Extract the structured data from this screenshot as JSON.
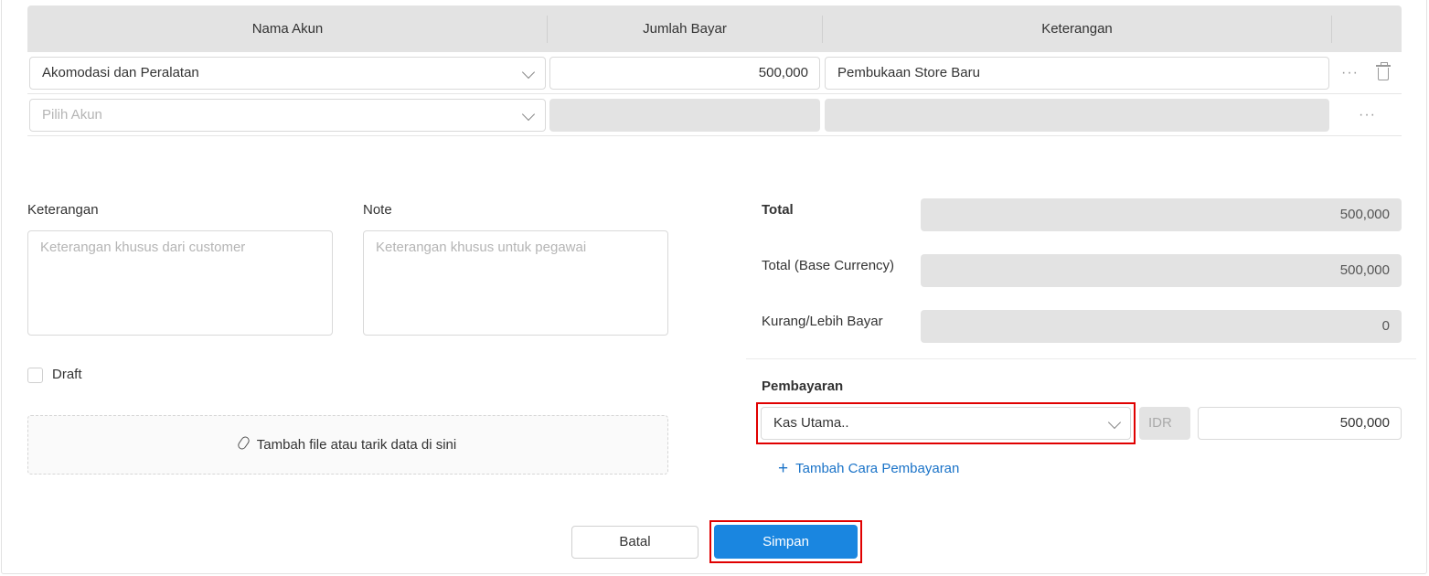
{
  "table": {
    "headers": [
      "Nama Akun",
      "Jumlah Bayar",
      "Keterangan"
    ],
    "rows": [
      {
        "account": "Akomodasi dan Peralatan",
        "amount": "500,000",
        "note": "Pembukaan Store Baru"
      }
    ],
    "new_row": {
      "account_placeholder": "Pilih Akun"
    },
    "more_icon_glyph": "···"
  },
  "memo": {
    "keterangan_label": "Keterangan",
    "keterangan_placeholder": "Keterangan khusus dari customer",
    "note_label": "Note",
    "note_placeholder": "Keterangan khusus untuk pegawai",
    "draft_label": "Draft",
    "attach_label": "Tambah file atau tarik data di sini"
  },
  "summary": {
    "total_label": "Total",
    "total_value": "500,000",
    "base_label": "Total (Base Currency)",
    "base_value": "500,000",
    "diff_label": "Kurang/Lebih Bayar",
    "diff_value": "0"
  },
  "payment": {
    "section_label": "Pembayaran",
    "method": "Kas Utama..",
    "currency": "IDR",
    "amount": "500,000",
    "add_label": "Tambah Cara Pembayaran",
    "add_glyph": "+"
  },
  "actions": {
    "cancel_label": "Batal",
    "save_label": "Simpan"
  },
  "colors": {
    "primary": "#1a86e0",
    "link": "#1a73c8",
    "highlight": "#e00000",
    "header_bg": "#e3e3e3"
  }
}
